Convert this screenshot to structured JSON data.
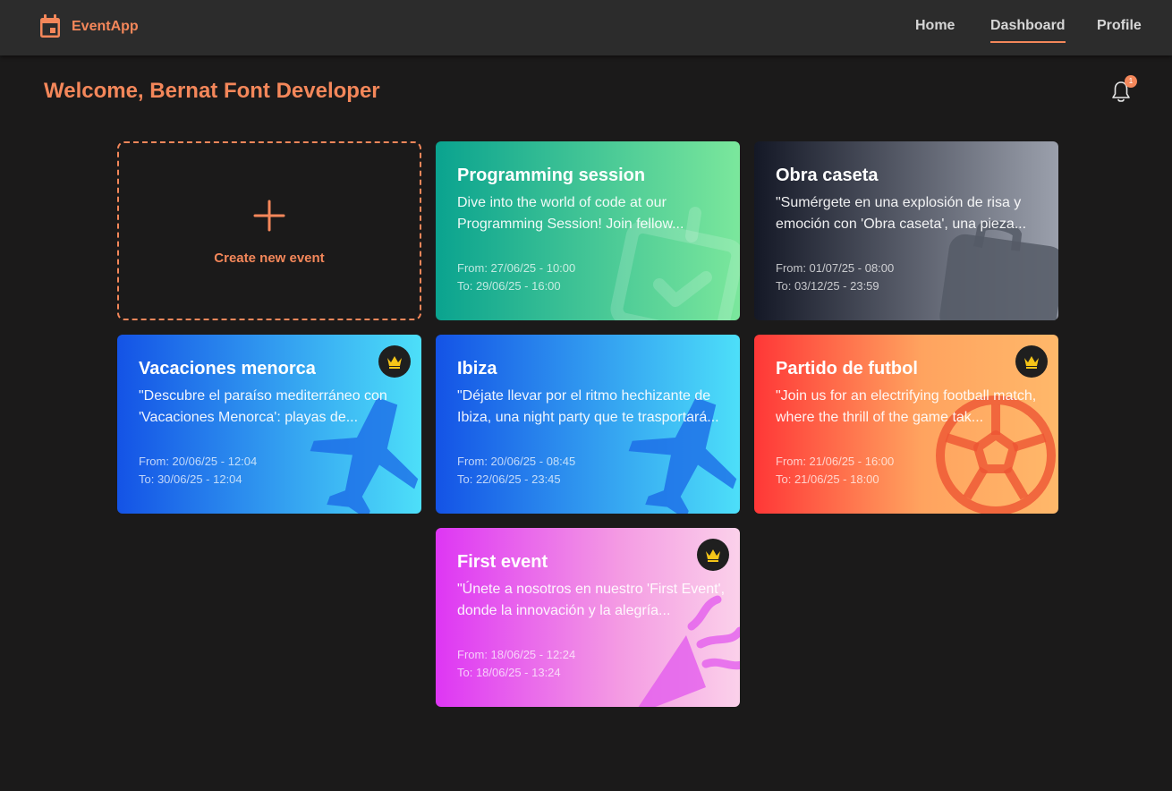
{
  "app": {
    "name": "EventApp",
    "brand_color": "#f4875a"
  },
  "nav": {
    "home": "Home",
    "dashboard": "Dashboard",
    "profile": "Profile",
    "active": "Dashboard"
  },
  "welcome": "Welcome, Bernat Font Developer",
  "notifications": {
    "count": "1",
    "icon": "bell-icon"
  },
  "create_card": {
    "label": "Create new event",
    "icon": "plus-icon"
  },
  "events": [
    {
      "title": "Programming session",
      "description": "Dive into the world of code at our Programming Session! Join fellow...",
      "from": "From: 27/06/25 - 10:00",
      "to": "To: 29/06/25 - 16:00",
      "icon": "calendar-check-icon",
      "premium": false,
      "gradient": [
        "#0aa38f",
        "#7be79c"
      ]
    },
    {
      "title": "Obra caseta",
      "description": "\"Sumérgete en una explosión de risa y emoción con 'Obra caseta', una pieza...",
      "from": "From: 01/07/25 - 08:00",
      "to": "To: 03/12/25 - 23:59",
      "icon": "briefcase-icon",
      "premium": false,
      "gradient": [
        "#141826",
        "#9ba0ac"
      ]
    },
    {
      "title": "Vacaciones menorca",
      "description": "\"Descubre el paraíso mediterráneo con 'Vacaciones Menorca': playas de...",
      "from": "From: 20/06/25 - 12:04",
      "to": "To: 30/06/25 - 12:04",
      "icon": "airplane-icon",
      "premium": true,
      "gradient": [
        "#1453e6",
        "#4ddff9"
      ]
    },
    {
      "title": "Ibiza",
      "description": "\"Déjate llevar por el ritmo hechizante de Ibiza, una night party que te trasportará...",
      "from": "From: 20/06/25 - 08:45",
      "to": "To: 22/06/25 - 23:45",
      "icon": "airplane-icon",
      "premium": false,
      "gradient": [
        "#1453e6",
        "#4ddff9"
      ]
    },
    {
      "title": "Partido de futbol",
      "description": "\"Join us for an electrifying football match, where the thrill of the game tak...",
      "from": "From: 21/06/25 - 16:00",
      "to": "To: 21/06/25 - 18:00",
      "icon": "soccer-ball-icon",
      "premium": true,
      "gradient": [
        "#ff3737",
        "#ffb86a"
      ]
    },
    {
      "title": "First event",
      "description": "\"Únete a nosotros en nuestro 'First Event', donde la innovación y la alegría...",
      "from": "From: 18/06/25 - 12:24",
      "to": "To: 18/06/25 - 13:24",
      "icon": "party-popper-icon",
      "premium": true,
      "gradient": [
        "#de36f4",
        "#fbd1ea"
      ]
    }
  ]
}
